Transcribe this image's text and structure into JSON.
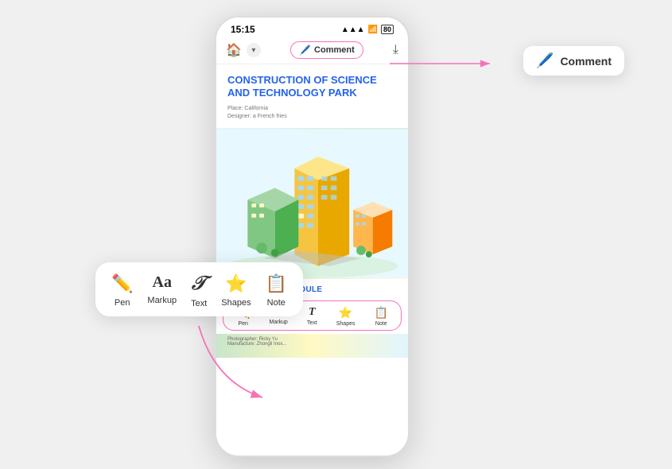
{
  "status": {
    "time": "15:15",
    "signal": "▲▲▲",
    "wifi": "WiFi",
    "battery": "80"
  },
  "appbar": {
    "comment_label": "Comment",
    "home_icon": "🏠",
    "chevron": "▾"
  },
  "document": {
    "title_line1": "CONSTRUCTION OF SCIENCE",
    "title_line2": "AND TECHNOLOGY PARK",
    "meta_place": "Place: California",
    "meta_designer": "Designer: a French fries",
    "section_label": "STRUCTURAL MODULE",
    "photo_caption1": "Photographer: Ricky Yu",
    "photo_caption2": "Manufacture: Zhongli Inox..."
  },
  "toolbar": {
    "tools": [
      {
        "id": "pen",
        "label": "Pen",
        "icon": "✏️"
      },
      {
        "id": "markup",
        "label": "Markup",
        "icon": "Aa"
      },
      {
        "id": "text",
        "label": "Text",
        "icon": "𝒯"
      },
      {
        "id": "shapes",
        "label": "Shapes",
        "icon": "⭐"
      },
      {
        "id": "note",
        "label": "Note",
        "icon": "📋"
      }
    ]
  },
  "comment_tooltip": {
    "icon": "🖊️",
    "label": "Comment"
  }
}
